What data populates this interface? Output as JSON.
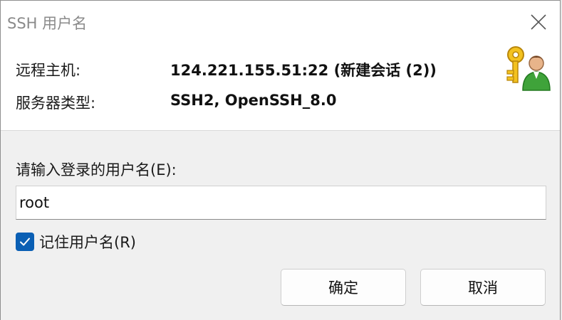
{
  "window": {
    "title": "SSH 用户名"
  },
  "info": {
    "remote_host_label": "远程主机:",
    "remote_host_value": "124.221.155.51:22 (新建会话 (2))",
    "server_type_label": "服务器类型:",
    "server_type_value": "SSH2, OpenSSH_8.0",
    "icon": "key-user-icon"
  },
  "form": {
    "prompt_label": "请输入登录的用户名(E):",
    "username_value": "root",
    "remember_label": "记住用户名(R)",
    "remember_checked": true
  },
  "buttons": {
    "ok_label": "确定",
    "cancel_label": "取消"
  },
  "colors": {
    "accent": "#0a5fb4",
    "title_text": "#8a8a8a"
  }
}
